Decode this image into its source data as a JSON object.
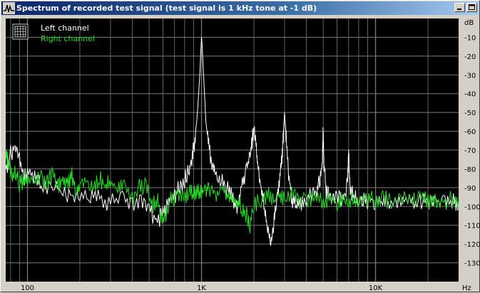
{
  "window": {
    "title": "Spectrum of recorded test signal (test signal is 1 kHz tone at -1 dB)"
  },
  "colors": {
    "plot_bg": "#000000",
    "grid": "#7a7a7a",
    "left_channel": "#ffffff",
    "right_channel": "#22dd22",
    "titlebar": "#0a246a"
  },
  "chart_data": {
    "type": "line",
    "title": "Spectrum of recorded test signal (test signal is 1 kHz tone at -1 dB)",
    "xscale": "log",
    "xlim": [
      75,
      30000
    ],
    "ylim": [
      -140,
      0
    ],
    "x_unit": "Hz",
    "y_unit": "dB",
    "x_ticks": [
      {
        "value": 100,
        "label": "100"
      },
      {
        "value": 1000,
        "label": "1K"
      },
      {
        "value": 10000,
        "label": "10K"
      }
    ],
    "y_ticks": [
      {
        "value": -10,
        "label": "-10"
      },
      {
        "value": -20,
        "label": "-20"
      },
      {
        "value": -30,
        "label": "-30"
      },
      {
        "value": -40,
        "label": "-40"
      },
      {
        "value": -50,
        "label": "-50"
      },
      {
        "value": -60,
        "label": "-60"
      },
      {
        "value": -70,
        "label": "-70"
      },
      {
        "value": -80,
        "label": "-80"
      },
      {
        "value": -90,
        "label": "-90"
      },
      {
        "value": -100,
        "label": "-100"
      },
      {
        "value": -110,
        "label": "-110"
      },
      {
        "value": -120,
        "label": "-120"
      },
      {
        "value": -130,
        "label": "-130"
      }
    ],
    "grid": true,
    "legend": {
      "position": "top-left",
      "icon": "grid-icon",
      "entries": [
        "Left channel",
        "Right channel"
      ]
    },
    "series": [
      {
        "name": "Left channel",
        "color": "#ffffff",
        "x": [
          75,
          80,
          85,
          90,
          95,
          100,
          110,
          120,
          140,
          160,
          180,
          200,
          230,
          260,
          300,
          350,
          400,
          450,
          500,
          550,
          600,
          650,
          700,
          750,
          800,
          850,
          880,
          910,
          940,
          960,
          980,
          990,
          1000,
          1010,
          1020,
          1040,
          1060,
          1100,
          1150,
          1200,
          1300,
          1400,
          1500,
          1600,
          1700,
          1800,
          1900,
          1950,
          2000,
          2050,
          2100,
          2200,
          2300,
          2400,
          2500,
          2600,
          2700,
          2800,
          2900,
          2950,
          3000,
          3050,
          3100,
          3200,
          3300,
          3500,
          3700,
          4000,
          4300,
          4600,
          4800,
          4950,
          5000,
          5050,
          5200,
          5500,
          6000,
          6500,
          6900,
          7000,
          7100,
          7500,
          8000,
          8500,
          9000,
          10000,
          11000,
          12000,
          14000,
          16000,
          18000,
          20000,
          22000,
          25000,
          28000,
          30000
        ],
        "y": [
          -80,
          -72,
          -68,
          -74,
          -86,
          -82,
          -84,
          -90,
          -88,
          -92,
          -94,
          -96,
          -94,
          -96,
          -98,
          -94,
          -100,
          -96,
          -102,
          -108,
          -104,
          -98,
          -94,
          -90,
          -86,
          -80,
          -76,
          -66,
          -54,
          -42,
          -28,
          -18,
          -10,
          -15,
          -24,
          -40,
          -55,
          -68,
          -78,
          -82,
          -86,
          -90,
          -95,
          -100,
          -88,
          -82,
          -74,
          -66,
          -58,
          -66,
          -78,
          -90,
          -100,
          -112,
          -118,
          -110,
          -96,
          -86,
          -74,
          -62,
          -50,
          -60,
          -72,
          -86,
          -96,
          -100,
          -98,
          -96,
          -94,
          -92,
          -86,
          -74,
          -60,
          -76,
          -92,
          -96,
          -94,
          -97,
          -88,
          -70,
          -88,
          -96,
          -95,
          -96,
          -97,
          -98,
          -97,
          -98,
          -97,
          -98,
          -97,
          -98,
          -97,
          -98,
          -97,
          -98
        ]
      },
      {
        "name": "Right channel",
        "color": "#22dd22",
        "x": [
          75,
          78,
          82,
          86,
          90,
          95,
          100,
          110,
          120,
          130,
          140,
          150,
          160,
          170,
          180,
          190,
          200,
          220,
          240,
          260,
          280,
          300,
          330,
          360,
          400,
          440,
          480,
          520,
          560,
          600,
          650,
          700,
          750,
          800,
          850,
          900,
          950,
          1000,
          1050,
          1100,
          1200,
          1300,
          1400,
          1500,
          1600,
          1700,
          1800,
          1900,
          2000,
          2200,
          2400,
          2600,
          2800,
          3000,
          3300,
          3600,
          4000,
          4500,
          5000,
          5500,
          6000,
          6500,
          7000,
          7500,
          8000,
          9000,
          10000,
          11000,
          12000,
          14000,
          16000,
          18000,
          20000,
          22000,
          25000,
          28000,
          30000
        ],
        "y": [
          -72,
          -78,
          -84,
          -82,
          -88,
          -86,
          -85,
          -86,
          -84,
          -88,
          -82,
          -90,
          -86,
          -88,
          -84,
          -92,
          -88,
          -86,
          -90,
          -84,
          -90,
          -86,
          -92,
          -88,
          -96,
          -90,
          -88,
          -100,
          -96,
          -110,
          -98,
          -94,
          -92,
          -96,
          -90,
          -94,
          -90,
          -94,
          -90,
          -92,
          -94,
          -90,
          -94,
          -96,
          -98,
          -100,
          -104,
          -110,
          -100,
          -96,
          -94,
          -98,
          -92,
          -96,
          -94,
          -97,
          -96,
          -95,
          -97,
          -96,
          -98,
          -95,
          -96,
          -97,
          -95,
          -96,
          -97,
          -96,
          -97,
          -96,
          -97,
          -96,
          -97,
          -96,
          -97,
          -96,
          -97
        ]
      }
    ]
  }
}
